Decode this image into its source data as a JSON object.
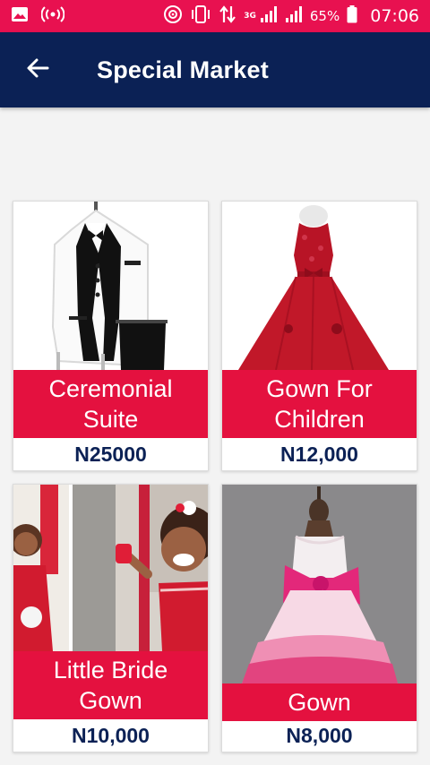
{
  "status_bar": {
    "network": "3G",
    "battery_percent": "65%",
    "time": "07:06",
    "icons": [
      "image-icon",
      "hotspot-icon",
      "nfc-icon",
      "vibrate-icon",
      "data-transfer-icon",
      "signal-icon",
      "signal-icon",
      "battery-icon"
    ]
  },
  "app_bar": {
    "title": "Special Market",
    "back_icon": "arrow-left-icon"
  },
  "colors": {
    "status_bar": "#e81150",
    "app_bar": "#0b2155",
    "label_bg": "#e4113f",
    "price_text": "#0b2155",
    "background": "#f3f3f3"
  },
  "products": [
    {
      "name": "Ceremonial Suite",
      "price": "N25000"
    },
    {
      "name": "Gown For Children",
      "price": "N12,000"
    },
    {
      "name": "Little Bride Gown",
      "price": "N10,000"
    },
    {
      "name": "Gown",
      "price": "N8,000"
    }
  ]
}
